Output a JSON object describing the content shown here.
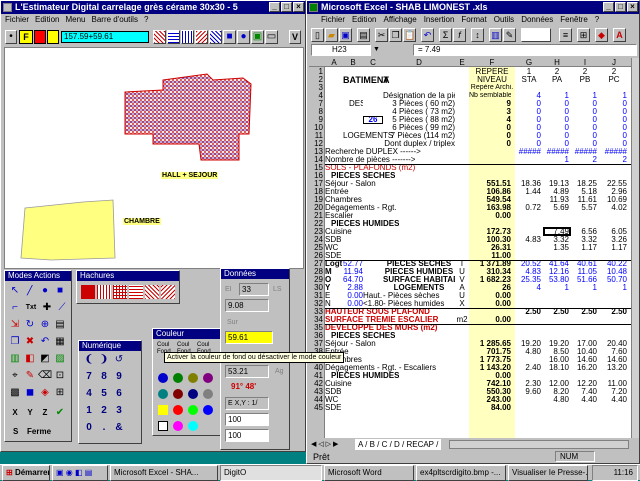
{
  "estimateur": {
    "title": "L'Estimateur Digital carrelage grès cérame 30x30 - 5",
    "menu": [
      "Fichier",
      "Edition",
      "Menu",
      "Barre d'outils",
      "?"
    ],
    "coord_input": "157.59+59.61",
    "toolbar_f": "F",
    "close_v": "V",
    "label_hall": "HALL + SEJOUR",
    "label_chambre": "CHAMBRE"
  },
  "palettes": {
    "modes_title": "Modes Actions",
    "modes_txt": "Txt",
    "modes_ferme": "Ferme",
    "modes_s": "S",
    "modes_xyz": [
      "X",
      "Y",
      "Z"
    ],
    "hachures_title": "Hachures",
    "numerique_title": "Numérique",
    "couleur_title": "Couleur",
    "couleur_row1": [
      "Coul",
      "Coul",
      "Coul"
    ],
    "couleur_row2": [
      "Fond",
      "Fond",
      "Fond"
    ],
    "donnees_title": "Données",
    "donnees_ei": "EI",
    "donnees_33": "33",
    "donnees_ls": "LS",
    "donnees_908": "9.08",
    "donnees_sur": "Sur",
    "donnees_5961": "59.61",
    "donnees_5321": "53.21",
    "donnees_ag": "Ag",
    "donnees_angle": "91° 48'",
    "donnees_exy": "E X,Y : 1/",
    "donnees_100a": "100",
    "donnees_100b": "100",
    "tooltip": "Activer la couleur de fond ou désactiver le mode couleur"
  },
  "excel": {
    "title": "Microsoft Excel - SHAB LIMONEST .xls",
    "menu": [
      "Fichier",
      "Edition",
      "Affichage",
      "Insertion",
      "Format",
      "Outils",
      "Données",
      "Fenêtre",
      "?"
    ],
    "namebox": "H23",
    "formula": "= 7.49",
    "columns": [
      "A",
      "B",
      "C",
      "D",
      "E",
      "F",
      "G",
      "H",
      "I",
      "J"
    ],
    "header_block": {
      "row1_f": "REPERE",
      "row1_g": "1",
      "row1_h": "2",
      "row1_i": "2",
      "row1_j": "2",
      "row2_f": "NIVEAU",
      "row2_g": "STA",
      "row2_h": "PA",
      "row2_i": "PB",
      "row2_j": "PC",
      "row3_f": "Repère Archi.",
      "batiment": "BATIMENT",
      "batiment_a": "A"
    },
    "rows": [
      {
        "n": "4",
        "a": "",
        "b": "",
        "c": "",
        "d": "Désignation de la pièce",
        "f": "Nb semblable",
        "g": "4",
        "h": "1",
        "i": "1",
        "j": "1"
      },
      {
        "n": "7",
        "a": "",
        "b": "DES",
        "c": "",
        "d": "3 Pièces ( 60 m2)",
        "f": "9",
        "g": "0",
        "h": "0",
        "i": "0",
        "j": "0"
      },
      {
        "n": "8",
        "a": "",
        "b": "",
        "c": "",
        "d": "4 Pièces ( 73 m2)",
        "f": "3",
        "g": "0",
        "h": "0",
        "i": "0",
        "j": "0"
      },
      {
        "n": "9",
        "a": "",
        "b": "",
        "c": "26",
        "d": "5 Pièces ( 88 m2)",
        "f": "4",
        "g": "0",
        "h": "0",
        "i": "0",
        "j": "0"
      },
      {
        "n": "10",
        "a": "",
        "b": "",
        "c": "",
        "d": "6 Pièces ( 99 m2)",
        "f": "0",
        "g": "0",
        "h": "0",
        "i": "0",
        "j": "0"
      },
      {
        "n": "11",
        "a": "",
        "b": "LOGEMENTS",
        "c": "",
        "d": "7 Pièces (114 m2)",
        "f": "0",
        "g": "0",
        "h": "0",
        "i": "0",
        "j": "0"
      },
      {
        "n": "12",
        "a": "",
        "b": "",
        "c": "",
        "d": "Dont duplex / triplex",
        "f": "0",
        "g": "0",
        "h": "0",
        "i": "0",
        "j": "0"
      },
      {
        "n": "13",
        "a": "Recherche DUPLEX ------>",
        "b": "",
        "c": "",
        "d": "",
        "f": "",
        "g": "#####",
        "h": "#####",
        "i": "#####",
        "j": "#####"
      },
      {
        "n": "14",
        "a": "Nombre de pièces ------->",
        "b": "",
        "c": "",
        "d": "",
        "f": "",
        "g": "",
        "h": "1",
        "i": "2",
        "j": "2"
      },
      {
        "n": "15",
        "a": "SOLS - PLAFONDS (m2)",
        "b": "",
        "c": "",
        "d": "",
        "f": "",
        "g": "",
        "h": "",
        "i": "",
        "j": ""
      },
      {
        "n": "16",
        "a": "PIECES SECHES",
        "b": "",
        "c": "",
        "d": "",
        "f": "",
        "g": "",
        "h": "",
        "i": "",
        "j": ""
      },
      {
        "n": "17",
        "a": "Séjour - Salon",
        "b": "",
        "c": "",
        "d": "",
        "f": "551.51",
        "g": "18.36",
        "h": "19.13",
        "i": "18.25",
        "j": "22.55"
      },
      {
        "n": "18",
        "a": "Entrée",
        "b": "",
        "c": "",
        "d": "",
        "f": "106.86",
        "g": "1.44",
        "h": "4.89",
        "i": "5.18",
        "j": "2.96"
      },
      {
        "n": "19",
        "a": "Chambres",
        "b": "",
        "c": "",
        "d": "",
        "f": "549.54",
        "g": "",
        "h": "11.93",
        "i": "11.61",
        "j": "10.69"
      },
      {
        "n": "20",
        "a": "Dégagements - Rgt.",
        "b": "",
        "c": "",
        "d": "",
        "f": "163.98",
        "g": "0.72",
        "h": "5.69",
        "i": "5.57",
        "j": "4.02"
      },
      {
        "n": "21",
        "a": "Escalier",
        "b": "",
        "c": "",
        "d": "",
        "f": "0.00",
        "g": "",
        "h": "",
        "i": "",
        "j": ""
      },
      {
        "n": "22",
        "a": "PIECES HUMIDES",
        "b": "",
        "c": "",
        "d": "",
        "f": "",
        "g": "",
        "h": "",
        "i": "",
        "j": ""
      },
      {
        "n": "23",
        "a": "Cuisine",
        "b": "",
        "c": "",
        "d": "",
        "f": "172.73",
        "g": "",
        "h": "7.49",
        "i": "6.56",
        "j": "6.05"
      },
      {
        "n": "24",
        "a": "SDB",
        "b": "",
        "c": "",
        "d": "",
        "f": "100.30",
        "g": "4.83",
        "h": "3.32",
        "i": "3.32",
        "j": "3.26"
      },
      {
        "n": "25",
        "a": "WC",
        "b": "",
        "c": "",
        "d": "",
        "f": "26.31",
        "g": "",
        "h": "1.35",
        "i": "1.17",
        "j": "1.17"
      },
      {
        "n": "26",
        "a": "SDE",
        "b": "",
        "c": "",
        "d": "",
        "f": "11.00",
        "g": "",
        "h": "",
        "i": "",
        "j": ""
      },
      {
        "n": "27",
        "a": "Logt",
        "b": "52.77",
        "c": "",
        "d": "PIECES SECHES",
        "e": "T",
        "f": "1 371.89",
        "g": "20.52",
        "h": "41.64",
        "i": "40.61",
        "j": "40.22"
      },
      {
        "n": "28",
        "a": "M",
        "b": "11.94",
        "c": "",
        "d": "PIECES HUMIDES",
        "e": "U",
        "f": "310.34",
        "g": "4.83",
        "h": "12.16",
        "i": "11.05",
        "j": "10.48"
      },
      {
        "n": "29",
        "a": "O",
        "b": "64.70",
        "c": "",
        "d": "SURFACE HABITABLE",
        "e": "V",
        "f": "1 682.23",
        "g": "25.35",
        "h": "53.80",
        "i": "51.66",
        "j": "50.70"
      },
      {
        "n": "30",
        "a": "Y",
        "b": "2.88",
        "c": "",
        "d": "LOGEMENTS",
        "e": "A",
        "f": "26",
        "g": "4",
        "h": "1",
        "i": "1",
        "j": "1"
      },
      {
        "n": "31",
        "a": "E",
        "b": "0.00",
        "c": "Haut.",
        "d": "- Pièces sèches",
        "e": "U",
        "f": "0.00",
        "g": "",
        "h": "",
        "i": "",
        "j": ""
      },
      {
        "n": "32",
        "a": "N",
        "b": "0.00",
        "c": "<1.80",
        "d": "- Pièces humides",
        "e": "X",
        "f": "0.00",
        "g": "",
        "h": "",
        "i": "",
        "j": ""
      },
      {
        "n": "33",
        "a": "HAUTEUR SOUS PLAFOND",
        "b": "",
        "c": "",
        "d": "",
        "f": "",
        "g": "2.50",
        "h": "2.50",
        "i": "2.50",
        "j": "2.50"
      },
      {
        "n": "34",
        "a": "SURFACE TREMIE ESCALIER",
        "b": "",
        "c": "",
        "d": "",
        "e": "m2",
        "f": "0.00",
        "g": "",
        "h": "",
        "i": "",
        "j": ""
      },
      {
        "n": "35",
        "a": "DEVELOPPE DES MURS (m2)",
        "b": "",
        "c": "",
        "d": "",
        "f": "",
        "g": "",
        "h": "",
        "i": "",
        "j": ""
      },
      {
        "n": "36",
        "a": "PIECES SECHES",
        "b": "",
        "c": "",
        "d": "",
        "f": "",
        "g": "",
        "h": "",
        "i": "",
        "j": ""
      },
      {
        "n": "37",
        "a": "Séjour - Salon",
        "b": "",
        "c": "",
        "d": "",
        "f": "1 285.65",
        "g": "19.20",
        "h": "19.20",
        "i": "17.00",
        "j": "20.40"
      },
      {
        "n": "38",
        "a": "Entrée",
        "b": "",
        "c": "",
        "d": "",
        "f": "701.75",
        "g": "4.80",
        "h": "8.50",
        "i": "10.40",
        "j": "7.60"
      },
      {
        "n": "39",
        "a": "Chambres",
        "b": "",
        "c": "",
        "d": "",
        "f": "1 773.75",
        "g": "",
        "h": "16.00",
        "i": "14.60",
        "j": "14.60"
      },
      {
        "n": "40",
        "a": "Dégagements - Rgt. - Escaliers",
        "b": "",
        "c": "",
        "d": "",
        "f": "1 143.20",
        "g": "2.40",
        "h": "18.10",
        "i": "16.20",
        "j": "13.20"
      },
      {
        "n": "41",
        "a": "PIECES HUMIDES",
        "b": "",
        "c": "",
        "d": "",
        "f": "0.00",
        "g": "",
        "h": "",
        "i": "",
        "j": ""
      },
      {
        "n": "42",
        "a": "Cuisine",
        "b": "",
        "c": "",
        "d": "",
        "f": "742.10",
        "g": "2.30",
        "h": "12.00",
        "i": "12.20",
        "j": "11.00"
      },
      {
        "n": "43",
        "a": "SDB",
        "b": "",
        "c": "",
        "d": "",
        "f": "550.30",
        "g": "9.60",
        "h": "8.20",
        "i": "7.40",
        "j": "7.20"
      },
      {
        "n": "44",
        "a": "WC",
        "b": "",
        "c": "",
        "d": "",
        "f": "243.00",
        "g": "",
        "h": "4.80",
        "i": "4.40",
        "j": "4.40"
      },
      {
        "n": "45",
        "a": "SDE",
        "b": "",
        "c": "",
        "d": "",
        "f": "84.00",
        "g": "",
        "h": "",
        "i": "",
        "j": ""
      }
    ],
    "sheet_tabs": "A / B / C / D / RECAP /",
    "status_ready": "Prêt",
    "status_num": "NUM"
  },
  "taskbar": {
    "start": "Démarrer",
    "items": [
      "Microsoft Excel - SHA...",
      "DigitO",
      "Microsoft Word",
      "ex4pltscrdigito.bmp -...",
      "Visualiser Ie Presse-..."
    ],
    "clock": "11:16"
  },
  "colors": {
    "titlebar": "#000080",
    "desktop": "#008080",
    "hatch_red": "#cc0000",
    "hatch_blue": "#0000cc",
    "room_fill": "#ffff80",
    "excel_blue": "#0000ff",
    "excel_red": "#cc0000",
    "yellow_col": "#ffffc0"
  }
}
